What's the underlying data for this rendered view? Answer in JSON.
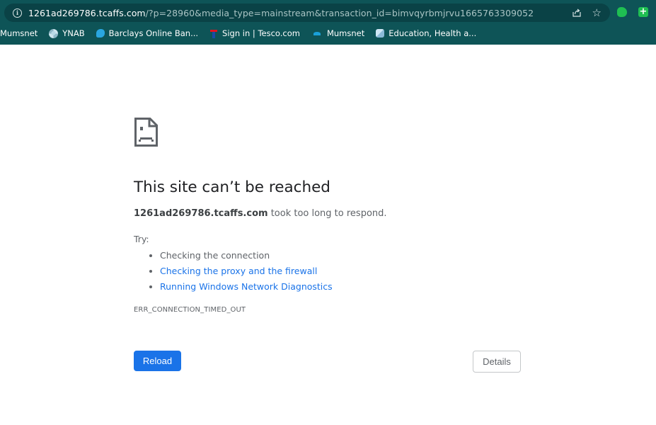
{
  "browser": {
    "url_host": "1261ad269786.tcaffs.com",
    "url_path": "/?p=28960&media_type=mainstream&transaction_id=bimvqyrbmjrvu1665763309052",
    "icons": {
      "site_info": "info-icon",
      "share": "share-icon",
      "bookmark_star": "star-icon",
      "extensions": [
        "evernote-icon",
        "plus-extension-icon"
      ]
    },
    "colors": {
      "toolbar": "#0e5457",
      "omnibox": "#0a4246"
    }
  },
  "bookmarks": [
    {
      "label": "Mumsnet",
      "icon": ""
    },
    {
      "label": "YNAB",
      "icon": "ynab-icon"
    },
    {
      "label": "Barclays Online Ban...",
      "icon": "barclays-eagle-icon"
    },
    {
      "label": "Sign in | Tesco.com",
      "icon": "tesco-icon"
    },
    {
      "label": "Mumsnet",
      "icon": "mumsnet-icon"
    },
    {
      "label": "Education, Health a...",
      "icon": "education-icon"
    }
  ],
  "error_page": {
    "icon": "sad-page-icon",
    "title": "This site can’t be reached",
    "host": "1261ad269786.tcaffs.com",
    "message": " took too long to respond.",
    "try_label": "Try:",
    "suggestions": [
      {
        "text": "Checking the connection",
        "link": false
      },
      {
        "text": "Checking the proxy and the firewall",
        "link": true
      },
      {
        "text": "Running Windows Network Diagnostics",
        "link": true
      }
    ],
    "error_code": "ERR_CONNECTION_TIMED_OUT",
    "reload_label": "Reload",
    "details_label": "Details",
    "colors": {
      "title": "#202124",
      "body": "#5f6368",
      "link": "#1a73e8",
      "primary_button": "#1a73e8"
    }
  }
}
